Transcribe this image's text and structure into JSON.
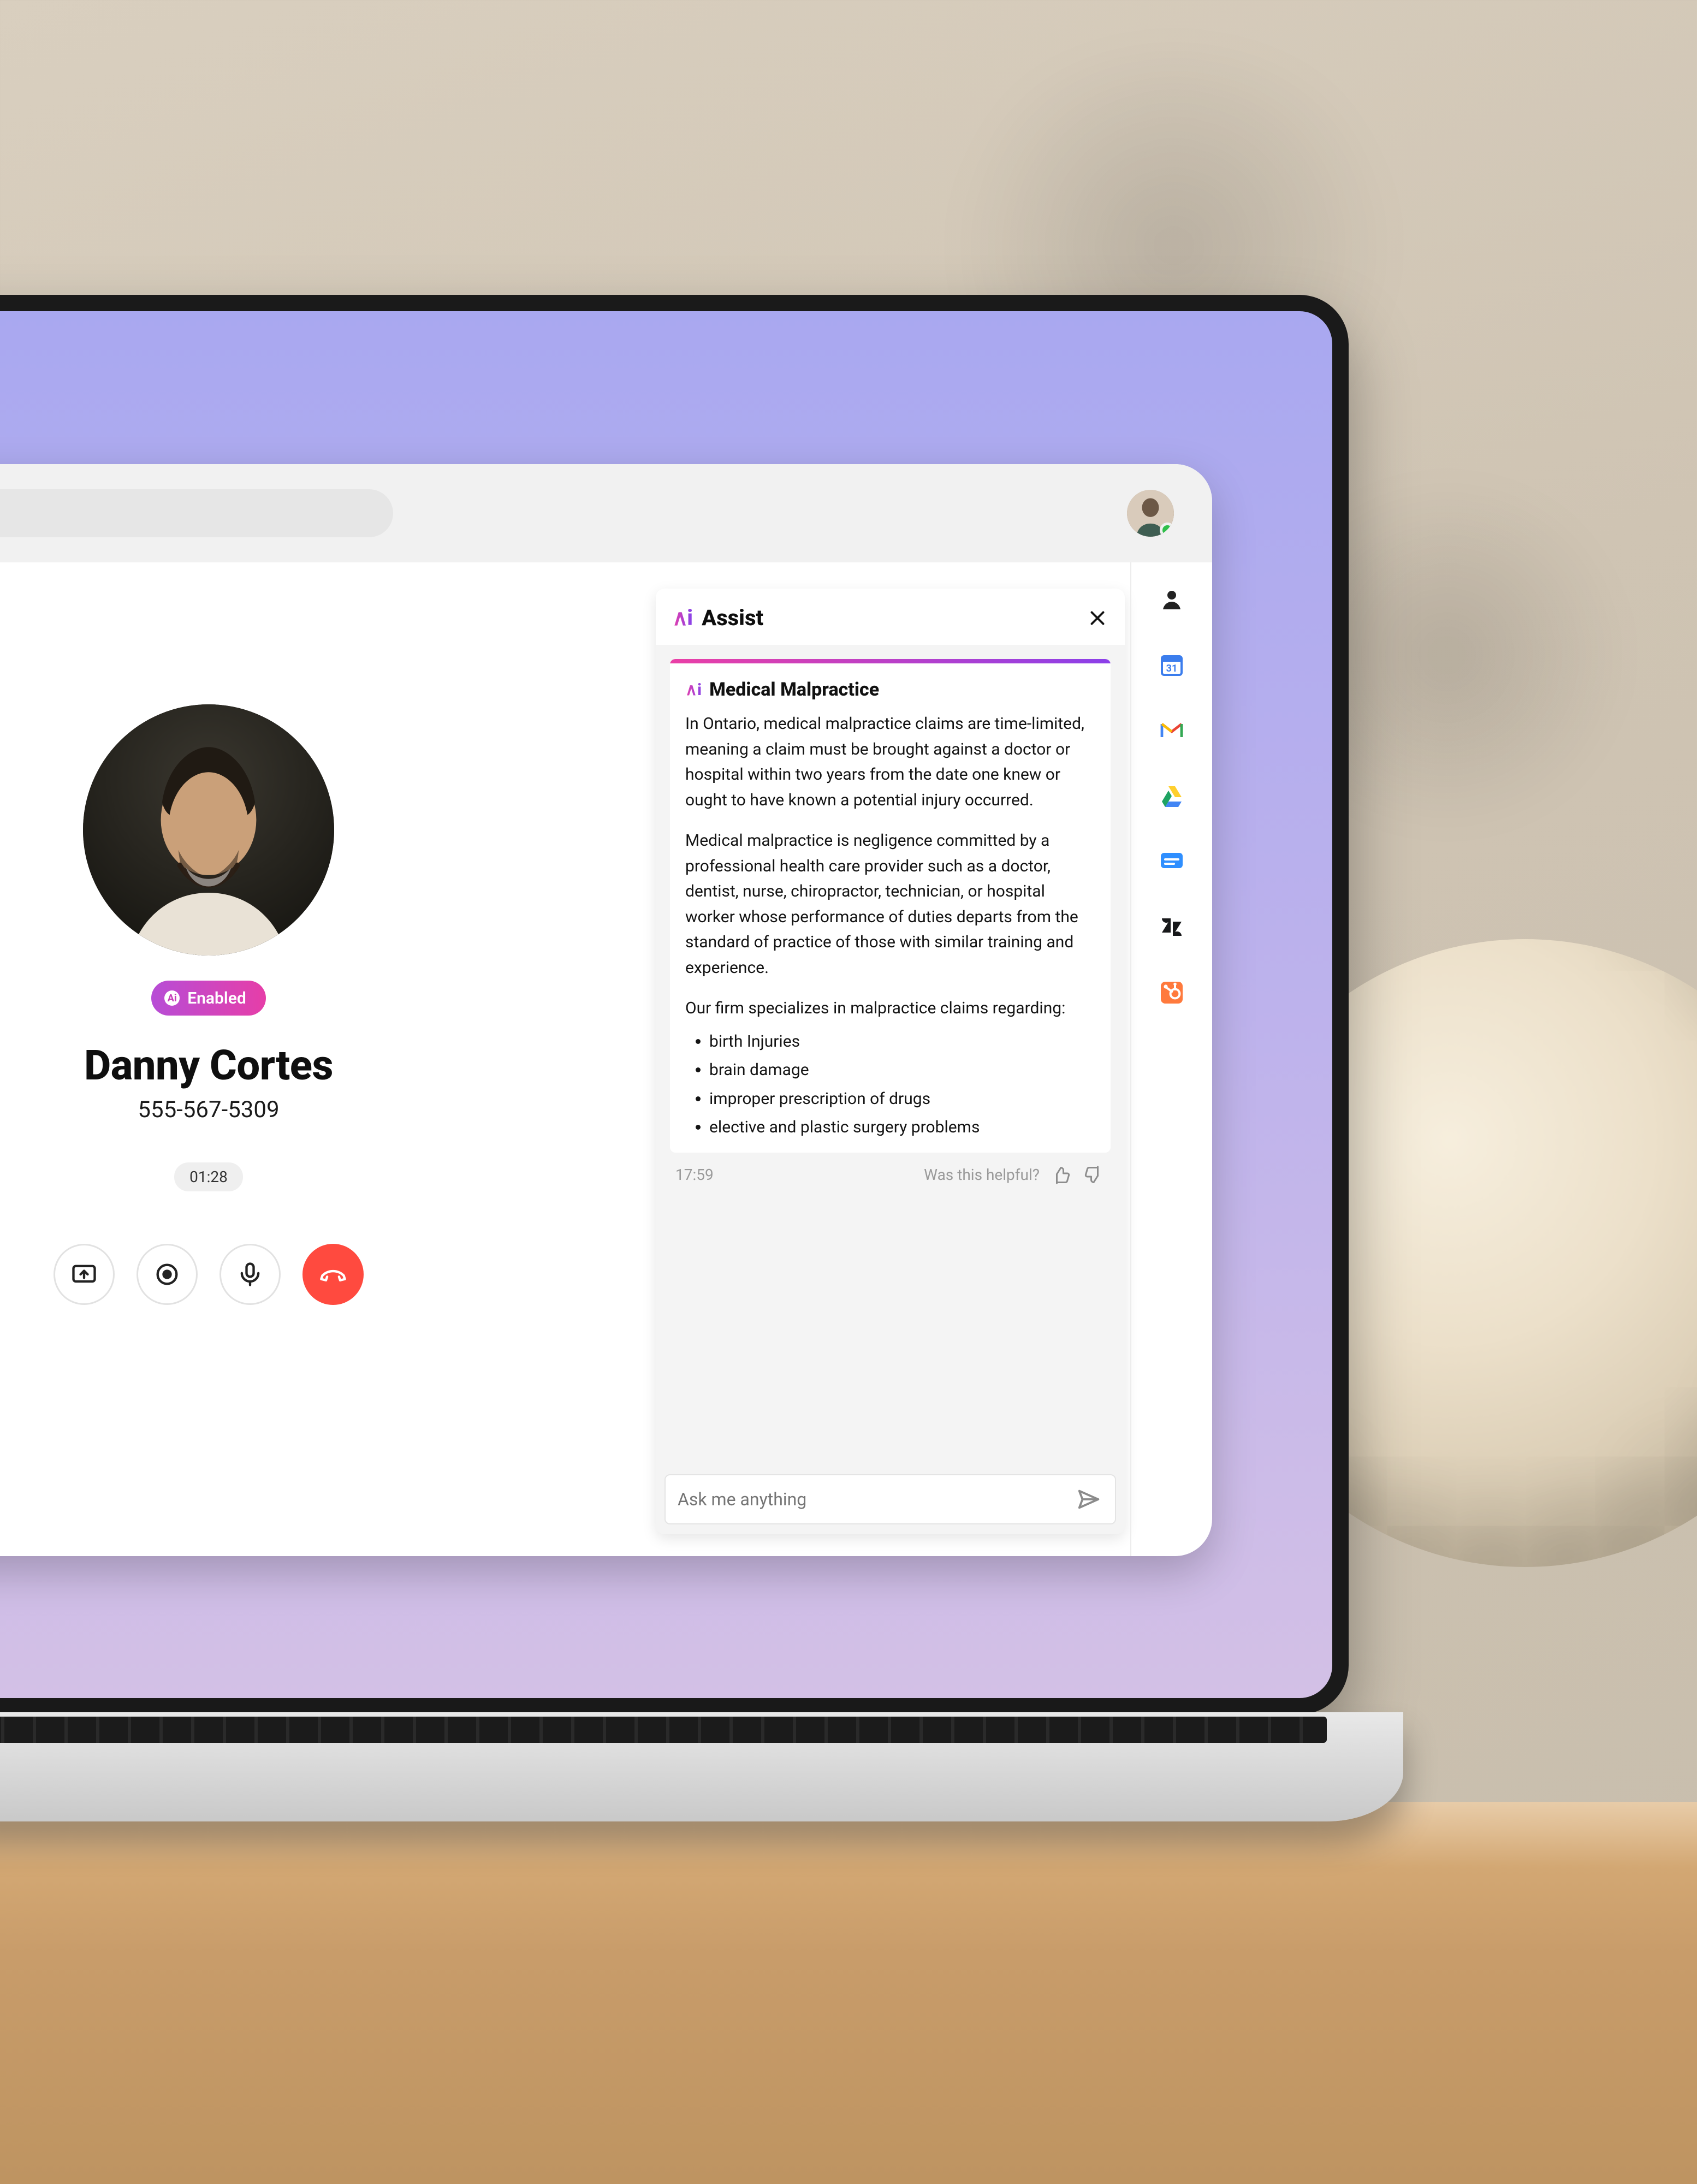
{
  "topbar": {
    "search_placeholder": ""
  },
  "call": {
    "ai_pill_label": "Enabled",
    "contact_name": "Danny Cortes",
    "contact_phone": "555-567-5309",
    "timer": "01:28"
  },
  "assist": {
    "panel_title": "Assist",
    "topic_title": "Medical Malpractice",
    "paragraph1": "In Ontario, medical malpractice claims are time-limited, meaning a claim must be brought against a doctor or hospital within two years from the date one knew or ought to have known a potential injury occurred.",
    "paragraph2": "Medical malpractice is negligence committed by a professional health care provider such as a doctor, dentist, nurse, chiropractor, technician, or hospital worker whose performance of duties departs from the standard of practice of those with similar training and experience.",
    "paragraph3": "Our firm specializes in malpractice claims regarding:",
    "bullets": {
      "0": "birth Injuries",
      "1": "brain damage",
      "2": "improper prescription of drugs",
      "3": "elective and plastic surgery problems"
    },
    "timestamp": "17:59",
    "feedback_prompt": "Was this helpful?",
    "input_placeholder": "Ask me anything"
  },
  "rail": {
    "items": {
      "0": "contact",
      "1": "calendar",
      "2": "gmail",
      "3": "google-drive",
      "4": "messages",
      "5": "zendesk",
      "6": "hubspot"
    }
  }
}
